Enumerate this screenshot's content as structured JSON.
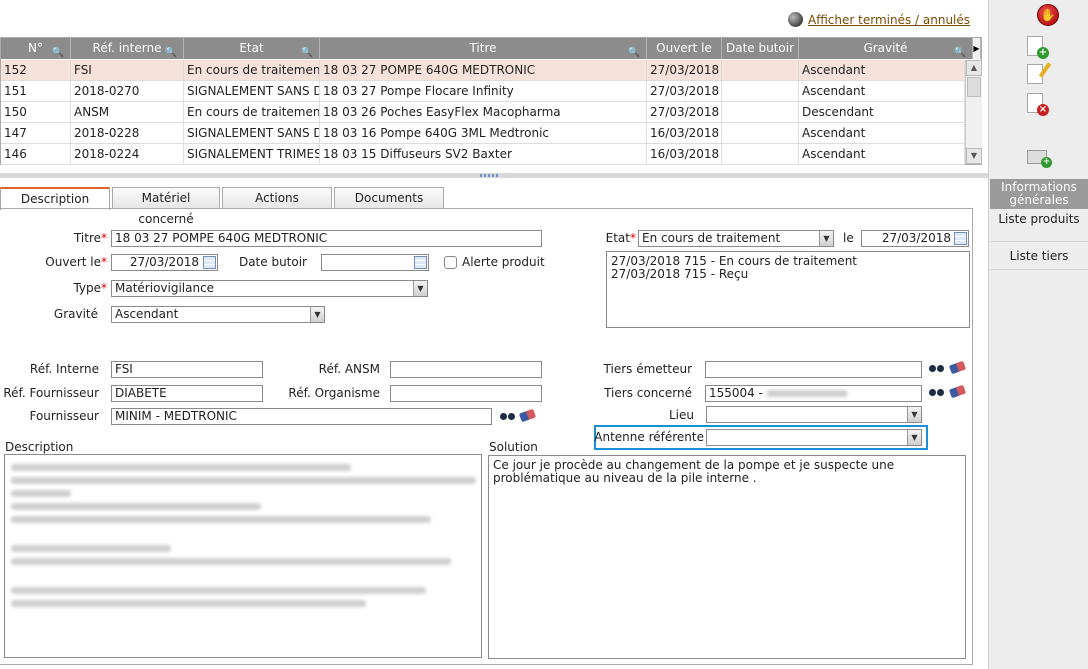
{
  "top_link": {
    "label": "Afficher terminés / annulés"
  },
  "grid": {
    "columns": [
      "N°",
      "Réf. interne",
      "Etat",
      "Titre",
      "Ouvert le",
      "Date butoir",
      "Gravité"
    ],
    "rows": [
      [
        "152",
        "FSI",
        "En cours de traitement",
        "18 03 27 POMPE 640G MEDTRONIC",
        "27/03/2018",
        "",
        "Ascendant"
      ],
      [
        "151",
        "2018-0270",
        "SIGNALEMENT SANS D",
        "18 03 27 Pompe Flocare Infinity",
        "27/03/2018",
        "",
        "Ascendant"
      ],
      [
        "150",
        "ANSM",
        "En cours de traitement",
        "18 03 26 Poches EasyFlex Macopharma",
        "27/03/2018",
        "",
        "Descendant"
      ],
      [
        "147",
        "2018-0228",
        "SIGNALEMENT SANS D",
        "18 03 16 Pompe 640G 3ML Medtronic",
        "16/03/2018",
        "",
        "Ascendant"
      ],
      [
        "146",
        "2018-0224",
        "SIGNALEMENT TRIMES",
        "18 03 15 Diffuseurs SV2 Baxter",
        "16/03/2018",
        "",
        "Ascendant"
      ]
    ]
  },
  "tabs": [
    "Description",
    "Matériel concerné",
    "Actions",
    "Documents"
  ],
  "form": {
    "titre_label": "Titre",
    "titre_value": "18 03 27 POMPE 640G MEDTRONIC",
    "ouvert_label": "Ouvert le",
    "ouvert_value": "27/03/2018",
    "butoir_label": "Date butoir",
    "butoir_value": "",
    "alerte_label": "Alerte produit",
    "type_label": "Type",
    "type_value": "Matériovigilance",
    "gravite_label": "Gravité",
    "gravite_value": "Ascendant",
    "etat_label": "Etat",
    "etat_value": "En cours de traitement",
    "le_label": "le",
    "le_value": "27/03/2018",
    "history": [
      "27/03/2018 715 - En cours de traitement",
      "27/03/2018 715 - Reçu"
    ],
    "ref_interne_label": "Réf. Interne",
    "ref_interne_value": "FSI",
    "ref_ansm_label": "Réf. ANSM",
    "ref_ansm_value": "",
    "ref_fournisseur_label": "Réf. Fournisseur",
    "ref_fournisseur_value": "DIABETE",
    "ref_organisme_label": "Réf. Organisme",
    "ref_organisme_value": "",
    "fournisseur_label": "Fournisseur",
    "fournisseur_value": "MINIM - MEDTRONIC",
    "tiers_emetteur_label": "Tiers émetteur",
    "tiers_emetteur_value": "",
    "tiers_concerne_label": "Tiers concerné",
    "tiers_concerne_value": "155004 -",
    "lieu_label": "Lieu",
    "lieu_value": "",
    "antenne_label": "Antenne référente",
    "antenne_value": "",
    "description_label": "Description",
    "solution_label": "Solution",
    "solution_value": "Ce jour   je procède au changement de la pompe et je suspecte une problématique au niveau de la pile interne ."
  },
  "sidebar": {
    "info_label": "Informations générales",
    "produits_label": "Liste produits",
    "tiers_label": "Liste tiers"
  },
  "colors": {
    "accent_tab": "#e0642a",
    "highlight": "#1a8ed9",
    "header_bg": "#8c8c8c",
    "selected_row": "#f6e2da"
  }
}
